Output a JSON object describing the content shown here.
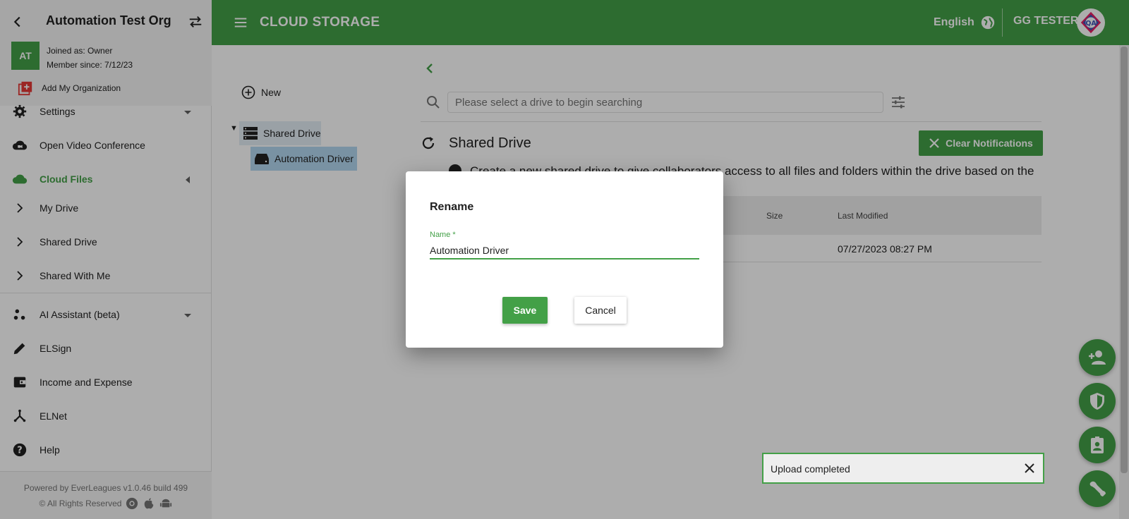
{
  "sidebar": {
    "org_name": "Automation Test Org",
    "avatar_initials": "AT",
    "joined_as": "Joined as: Owner",
    "member_since": "Member since: 7/12/23",
    "add_org": "Add My Organization",
    "items": [
      {
        "label": "Settings",
        "icon": "gear-icon"
      },
      {
        "label": "Open Video Conference",
        "icon": "video-cloud-icon"
      },
      {
        "label": "Cloud Files",
        "icon": "cloud-icon"
      },
      {
        "label": "My Drive",
        "icon": "chevron-right-icon"
      },
      {
        "label": "Shared Drive",
        "icon": "chevron-right-icon"
      },
      {
        "label": "Shared With Me",
        "icon": "chevron-right-icon"
      },
      {
        "label": "AI Assistant (beta)",
        "icon": "ai-dots-icon"
      },
      {
        "label": "ELSign",
        "icon": "pencil-icon"
      },
      {
        "label": "Income and Expense",
        "icon": "wallet-icon"
      },
      {
        "label": "ELNet",
        "icon": "network-icon"
      },
      {
        "label": "Help",
        "icon": "help-icon"
      }
    ],
    "footer_powered": "Powered by EverLeagues v1.0.46 build 499",
    "footer_rights": "© All Rights Reserved"
  },
  "topbar": {
    "title": "CLOUD STORAGE",
    "language": "English",
    "user": "GG TESTER"
  },
  "content": {
    "new_label": "New",
    "tree": {
      "root": "Shared Drive",
      "child": "Automation Driver"
    },
    "search_placeholder": "Please select a drive to begin searching",
    "panel_title": "Shared Drive",
    "clear_notifications": "Clear Notifications",
    "info_text": "Create a new shared drive to give collaborators access to all files and folders within the drive based on the",
    "table": {
      "columns": [
        "Size",
        "Last Modified"
      ],
      "rows": [
        {
          "last_modified": "07/27/2023 08:27 PM"
        }
      ]
    }
  },
  "toast": {
    "message": "Upload completed"
  },
  "dialog": {
    "title": "Rename",
    "field_label": "Name",
    "required_mark": "*",
    "field_value": "Automation Driver",
    "save": "Save",
    "cancel": "Cancel"
  },
  "colors": {
    "primary": "#43a047",
    "selected_tree": "#b3d7f0"
  }
}
